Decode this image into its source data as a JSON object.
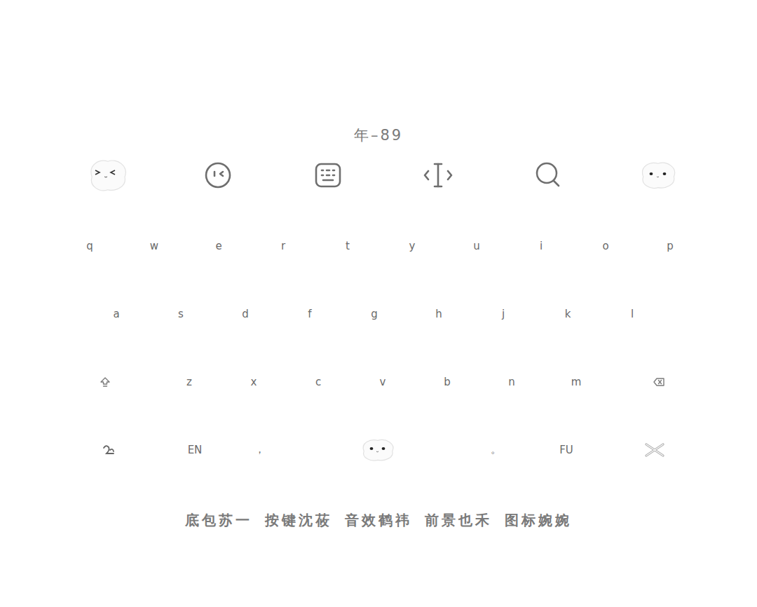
{
  "title": "年–89",
  "keyboard": {
    "rows": [
      [
        "q",
        "w",
        "e",
        "r",
        "t",
        "y",
        "u",
        "i",
        "o",
        "p"
      ],
      [
        "a",
        "s",
        "d",
        "f",
        "g",
        "h",
        "j",
        "k",
        "l"
      ],
      [
        "z",
        "x",
        "c",
        "v",
        "b",
        "n",
        "m"
      ]
    ],
    "function_row": [
      {
        "kind": "symbols"
      },
      {
        "kind": "key",
        "label": "EN"
      },
      {
        "kind": "key",
        "label": "，"
      },
      {
        "kind": "space"
      },
      {
        "kind": "key",
        "label": "。"
      },
      {
        "kind": "key",
        "label": "FU"
      },
      {
        "kind": "hide"
      }
    ]
  },
  "credits": [
    "底包苏一",
    "按键沈莜",
    "音效鹤祎",
    "前景也禾",
    "图标婉婉"
  ]
}
